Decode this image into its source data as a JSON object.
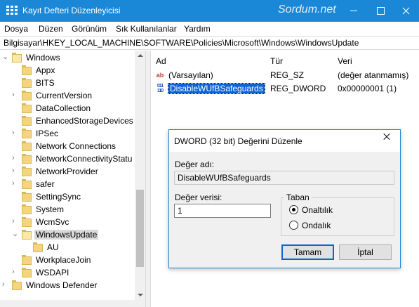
{
  "window": {
    "title": "Kayıt Defteri Düzenleyicisi",
    "watermark": "Sordum.net"
  },
  "menu": [
    "Dosya",
    "Düzen",
    "Görünüm",
    "Sık Kullanılanlar",
    "Yardım"
  ],
  "address": "Bilgisayar\\HKEY_LOCAL_MACHINE\\SOFTWARE\\Policies\\Microsoft\\Windows\\WindowsUpdate",
  "tree": {
    "items": [
      {
        "label": "Windows",
        "level": 0,
        "expanded": true
      },
      {
        "label": "Appx",
        "level": 1
      },
      {
        "label": "BITS",
        "level": 1
      },
      {
        "label": "CurrentVersion",
        "level": 1,
        "has_children": true
      },
      {
        "label": "DataCollection",
        "level": 1
      },
      {
        "label": "EnhancedStorageDevices",
        "level": 1
      },
      {
        "label": "IPSec",
        "level": 1,
        "has_children": true
      },
      {
        "label": "Network Connections",
        "level": 1
      },
      {
        "label": "NetworkConnectivityStatu",
        "level": 1,
        "has_children": true
      },
      {
        "label": "NetworkProvider",
        "level": 1,
        "has_children": true
      },
      {
        "label": "safer",
        "level": 1,
        "has_children": true
      },
      {
        "label": "SettingSync",
        "level": 1
      },
      {
        "label": "System",
        "level": 1
      },
      {
        "label": "WcmSvc",
        "level": 1,
        "has_children": true
      },
      {
        "label": "WindowsUpdate",
        "level": 1,
        "expanded": true,
        "selected": true
      },
      {
        "label": "AU",
        "level": 2
      },
      {
        "label": "WorkplaceJoin",
        "level": 1
      },
      {
        "label": "WSDAPI",
        "level": 1,
        "has_children": true
      },
      {
        "label": "Windows Defender",
        "level": 0,
        "has_children": true
      }
    ]
  },
  "list": {
    "headers": {
      "name": "Ad",
      "type": "Tür",
      "data": "Veri"
    },
    "rows": [
      {
        "name": "(Varsayılan)",
        "type": "REG_SZ",
        "data": "(değer atanmamış)",
        "icon": "string-value-icon",
        "icon_text": "ab"
      },
      {
        "name": "DisableWUfBSafeguards",
        "type": "REG_DWORD",
        "data": "0x00000001 (1)",
        "icon": "binary-value-icon",
        "icon_text": "011\n110",
        "selected": true
      }
    ]
  },
  "dialog": {
    "title": "DWORD (32 bit) Değerini Düzenle",
    "name_label": "Değer adı:",
    "name_value": "DisableWUfBSafeguards",
    "data_label": "Değer verisi:",
    "data_value": "1",
    "base_label": "Taban",
    "base_options": [
      {
        "label": "Onaltılık",
        "checked": true
      },
      {
        "label": "Ondalık",
        "checked": false
      }
    ],
    "ok_label": "Tamam",
    "cancel_label": "İptal"
  },
  "colors": {
    "titlebar": "#1a88d6",
    "selection": "#0a64d6",
    "folder": "#f4d57d"
  }
}
